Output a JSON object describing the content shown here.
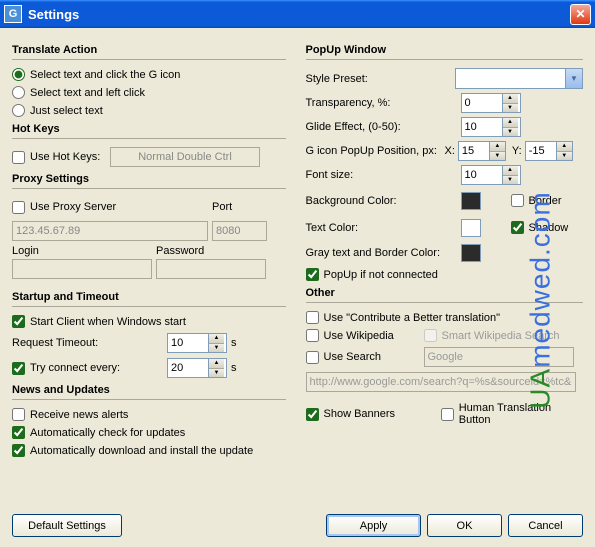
{
  "window": {
    "title": "Settings"
  },
  "left": {
    "translate": {
      "heading": "Translate Action",
      "opt1": "Select text and click the G icon",
      "opt2": "Select text and left click",
      "opt3": "Just select text"
    },
    "hotkeys": {
      "heading": "Hot Keys",
      "use_label": "Use Hot Keys:",
      "value": "Normal Double Ctrl"
    },
    "proxy": {
      "heading": "Proxy Settings",
      "use_label": "Use Proxy Server",
      "port_label": "Port",
      "host_value": "123.45.67.89",
      "port_value": "8080",
      "login_label": "Login",
      "password_label": "Password"
    },
    "startup": {
      "heading": "Startup and Timeout",
      "start_label": "Start Client when Windows start",
      "req_timeout_label": "Request Timeout:",
      "req_timeout_value": "10",
      "req_timeout_unit": "s",
      "try_label": "Try connect every:",
      "try_value": "20",
      "try_unit": "s"
    },
    "news": {
      "heading": "News and Updates",
      "receive_label": "Receive news alerts",
      "autocheck_label": "Automatically check for updates",
      "autodl_label": "Automatically download and install the update"
    }
  },
  "right": {
    "popup": {
      "heading": "PopUp Window",
      "style_label": "Style Preset:",
      "transparency_label": "Transparency, %:",
      "transparency_value": "0",
      "glide_label": "Glide Effect, (0-50):",
      "glide_value": "10",
      "pos_label": "G icon PopUp Position, px:",
      "x_label": "X:",
      "x_value": "15",
      "y_label": "Y:",
      "y_value": "-15",
      "font_label": "Font size:",
      "font_value": "10",
      "bg_label": "Background Color:",
      "bg_color": "#2b2b2b",
      "text_label": "Text Color:",
      "text_color": "#ffffff",
      "gray_label": "Gray text and Border Color:",
      "gray_color": "#2b2b2b",
      "border_label": "Border",
      "shadow_label": "Shadow",
      "popup_not_connected_label": "PopUp if not connected"
    },
    "other": {
      "heading": "Other",
      "contribute_label": "Use \"Contribute a Better translation\"",
      "wikipedia_label": "Use Wikipedia",
      "smart_label": "Smart Wikipedia Search",
      "search_label": "Use Search",
      "search_value": "Google",
      "search_url": "http://www.google.com/search?q=%s&sourceid=%tc&ie",
      "banners_label": "Show Banners",
      "human_label": "Human Translation Button"
    }
  },
  "footer": {
    "default": "Default Settings",
    "apply": "Apply",
    "ok": "OK",
    "cancel": "Cancel"
  },
  "watermark": {
    "text_green": "UA",
    "text_blue": "medwed.com"
  }
}
